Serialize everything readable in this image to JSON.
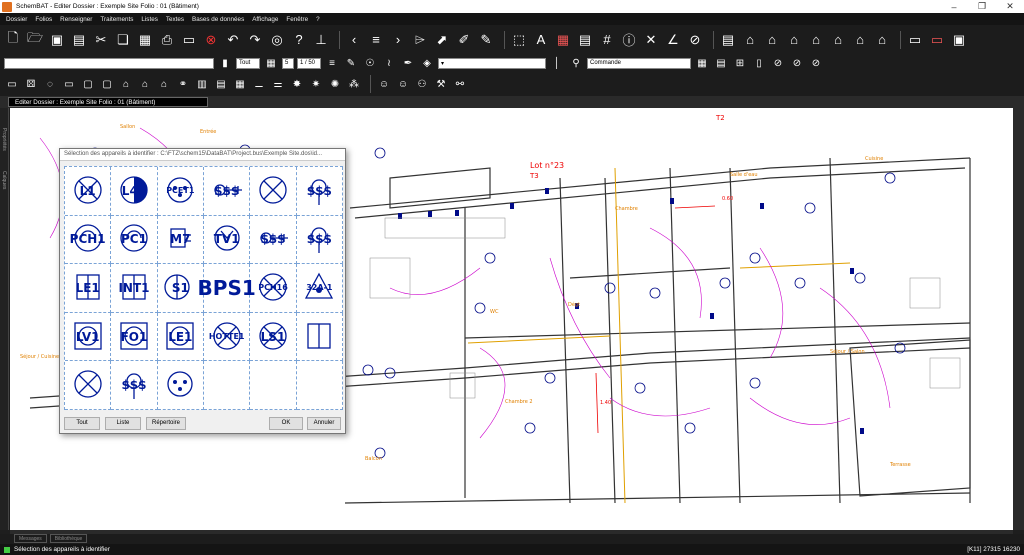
{
  "app": {
    "title": "SchemBAT - Editer Dossier : Exemple Site  Folio : 01 (Bâtiment)"
  },
  "menu": [
    "Dossier",
    "Folios",
    "Renseigner",
    "Traitements",
    "Listes",
    "Textes",
    "Bases de données",
    "Affichage",
    "Fenêtre",
    "?"
  ],
  "toolbar2": {
    "layer_value": "Tout",
    "page_current": "5",
    "page_range": "1 / 50",
    "style_value": "Commande"
  },
  "doc_tab": "Editer Dossier : Exemple Site  Folio : 01 (Bâtiment)",
  "sidebar": [
    "Propriétés",
    "Calques"
  ],
  "dialog": {
    "title": "Sélection des appareils à identifier : C:\\FTZ\\schem15\\DataBAT\\Project.bus\\Exemple Site.dos\\id...",
    "cells": [
      {
        "label": "L1",
        "symbol": "circle-x"
      },
      {
        "label": "L46",
        "symbol": "half-filled-circle"
      },
      {
        "label": "PCET1",
        "symbol": "socket"
      },
      {
        "label": "$$$",
        "symbol": "switch"
      },
      {
        "label": "",
        "symbol": "circle-x"
      },
      {
        "label": "$$$",
        "symbol": "circle-small"
      },
      {
        "label": "PCH1",
        "symbol": "socket-circle"
      },
      {
        "label": "PC1",
        "symbol": "socket-circle"
      },
      {
        "label": "M7",
        "symbol": "rect-plug"
      },
      {
        "label": "TV1",
        "symbol": "tv-outlet"
      },
      {
        "label": "$$$",
        "symbol": "switch"
      },
      {
        "label": "$$$",
        "symbol": "circle-small"
      },
      {
        "label": "LE1",
        "symbol": "box"
      },
      {
        "label": "INT1",
        "symbol": "box"
      },
      {
        "label": "S1",
        "symbol": "circle-half"
      },
      {
        "label": "BPS1",
        "symbol": "text"
      },
      {
        "label": "PCH16",
        "symbol": "circle-x"
      },
      {
        "label": "32A-1",
        "symbol": "triangle"
      },
      {
        "label": "LV1",
        "symbol": "square-circle"
      },
      {
        "label": "FO1",
        "symbol": "square-circle"
      },
      {
        "label": "LE1",
        "symbol": "square-circle"
      },
      {
        "label": "HOTTE1",
        "symbol": "circle-x"
      },
      {
        "label": "LS1",
        "symbol": "circle-x"
      },
      {
        "label": "",
        "symbol": "box"
      },
      {
        "label": "",
        "symbol": "circle-x"
      },
      {
        "label": "$$$",
        "symbol": "circle-small"
      },
      {
        "label": "",
        "symbol": "socket"
      },
      {
        "label": "",
        "symbol": ""
      },
      {
        "label": "",
        "symbol": ""
      },
      {
        "label": "",
        "symbol": ""
      }
    ],
    "buttons": {
      "all": "Tout",
      "list": "Liste",
      "directory": "Répertoire",
      "ok": "OK",
      "cancel": "Annuler"
    }
  },
  "plan_labels": [
    "Sallon",
    "Entrée",
    "Lot n°23",
    "T3",
    "T2",
    "Chambre",
    "Salle d'eau",
    "Cuisine",
    "Séjour / Salon",
    "WC",
    "Dégt",
    "Terrasse",
    "Balcon",
    "Séjour / Cuisine",
    "Chambre 2",
    "0.60",
    "1.40"
  ],
  "bottom_tabs": [
    "Messages",
    "Bibliothèque"
  ],
  "status": {
    "message": "Sélection des appareils à identifier",
    "coords": "[K11]  27315  16230"
  },
  "colors": {
    "accent": "#e07020",
    "symbol": "#001a99",
    "wall": "#333333"
  }
}
